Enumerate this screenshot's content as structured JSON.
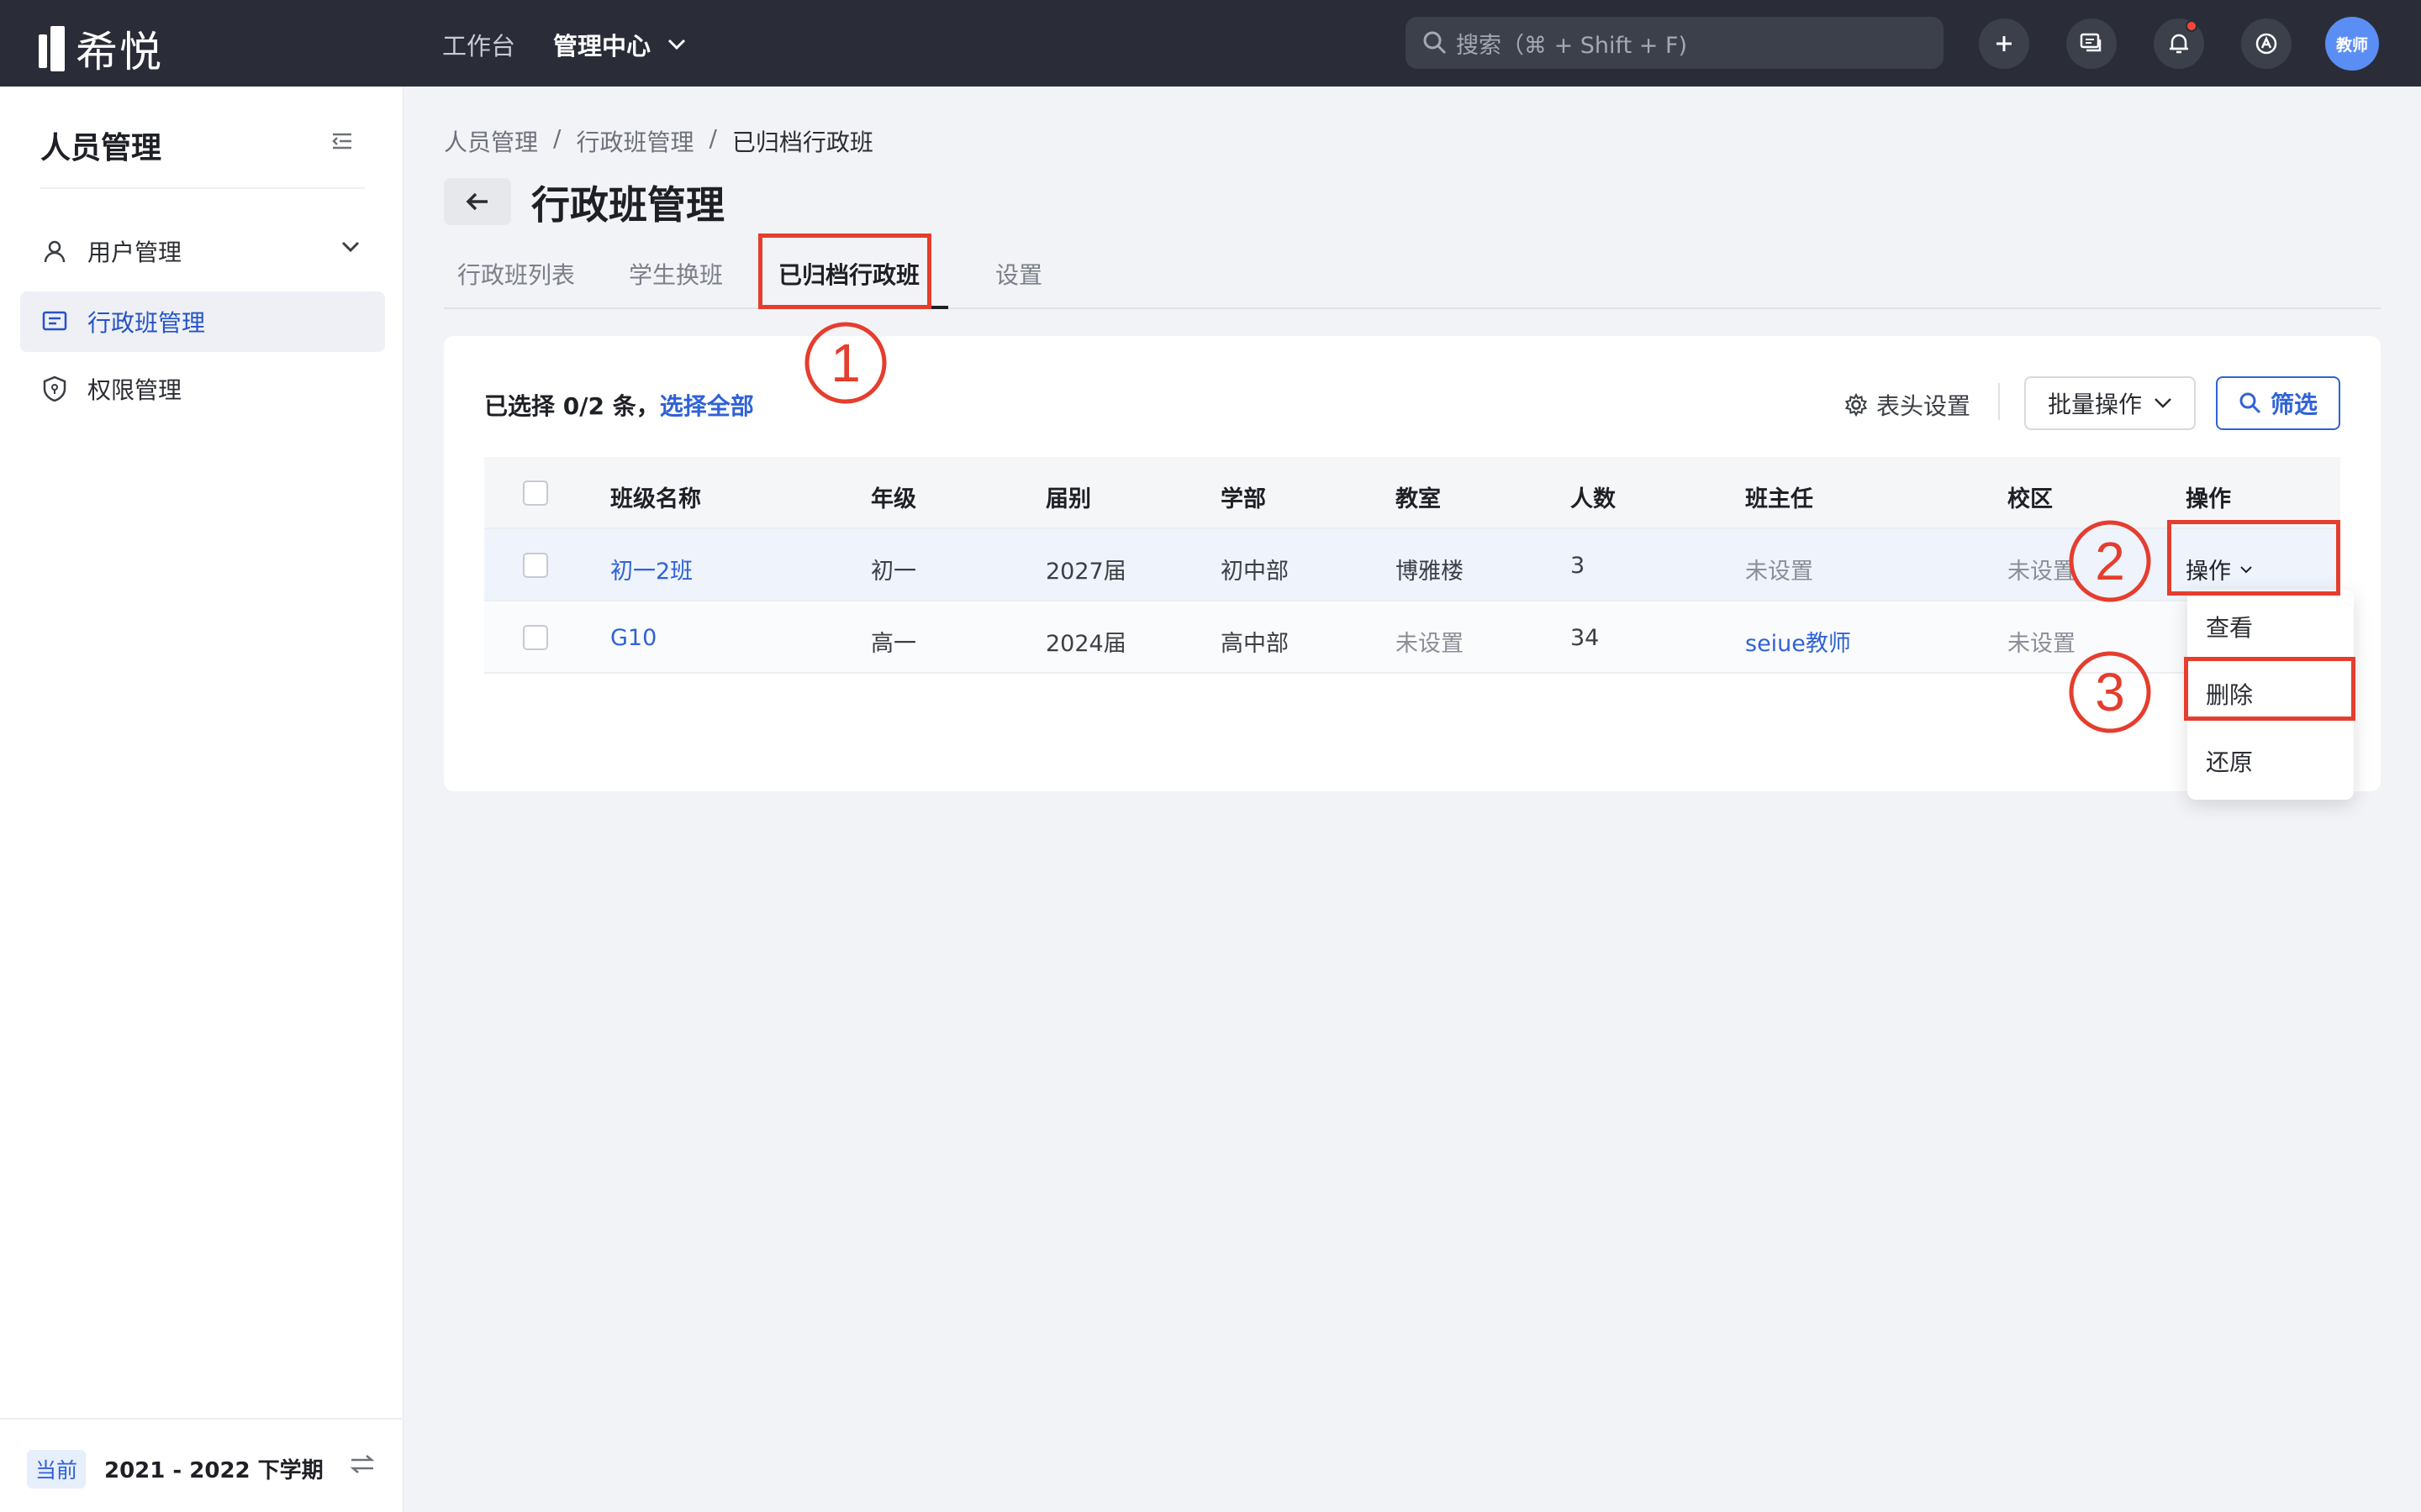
{
  "topbar": {
    "logo_text": "希悦",
    "nav": {
      "workbench": "工作台",
      "admin_center": "管理中心"
    },
    "search_placeholder": "搜索（⌘ + Shift + F)",
    "icons": [
      "plus-icon",
      "message-icon",
      "bell-icon",
      "app-icon"
    ],
    "avatar_text": "教师"
  },
  "sidebar": {
    "title": "人员管理",
    "items": [
      {
        "label": "用户管理",
        "icon": "user-icon"
      },
      {
        "label": "行政班管理",
        "icon": "list-icon",
        "active": true
      },
      {
        "label": "权限管理",
        "icon": "shield-icon"
      }
    ],
    "footer": {
      "badge": "当前",
      "term": "2021 - 2022 下学期"
    }
  },
  "breadcrumb": [
    "人员管理",
    "/",
    "行政班管理",
    "/",
    "已归档行政班"
  ],
  "page_title": "行政班管理",
  "tabs": [
    "行政班列表",
    "学生换班",
    "已归档行政班",
    "设置"
  ],
  "toolbar": {
    "selected_prefix": "已选择 0/2 条，",
    "select_all": "选择全部",
    "column_settings": "表头设置",
    "batch_ops": "批量操作",
    "filter": "筛选"
  },
  "table": {
    "headers": [
      "班级名称",
      "年级",
      "届别",
      "学部",
      "教室",
      "人数",
      "班主任",
      "校区",
      "操作"
    ],
    "rows": [
      {
        "name": "初一2班",
        "grade": "初一",
        "cohort": "2027届",
        "dept": "初中部",
        "room": "博雅楼",
        "count": "3",
        "teacher": "未设置",
        "campus": "未设置",
        "action": "操作"
      },
      {
        "name": "G10",
        "grade": "高一",
        "cohort": "2024届",
        "dept": "高中部",
        "room": "未设置",
        "count": "34",
        "teacher": "seiue教师",
        "campus": "未设置",
        "action": ""
      }
    ]
  },
  "dropdown": [
    "查看",
    "删除",
    "还原"
  ],
  "annotations": [
    "1",
    "2",
    "3"
  ],
  "colors": {
    "accent": "#2f62d6",
    "annotation_red": "#e53d2e",
    "topbar": "#2a2d37"
  }
}
